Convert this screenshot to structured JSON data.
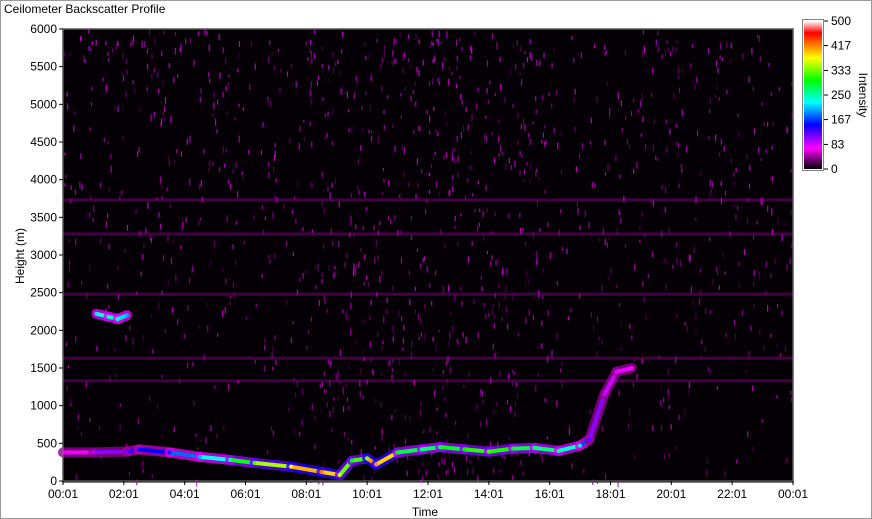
{
  "window": {
    "title": "Ceilometer Backscatter Profile"
  },
  "chart_data": {
    "type": "heatmap",
    "title": "Ceilometer Backscatter Profile",
    "xlabel": "Time",
    "ylabel": "Height (m)",
    "x_ticks": [
      "00:01",
      "02:01",
      "04:01",
      "06:01",
      "08:01",
      "10:01",
      "12:01",
      "14:01",
      "16:01",
      "18:01",
      "20:01",
      "22:01",
      "00:01"
    ],
    "x_range_hours": [
      0,
      24
    ],
    "y_ticks": [
      0,
      500,
      1000,
      1500,
      2000,
      2500,
      3000,
      3500,
      4000,
      4500,
      5000,
      5500,
      6000
    ],
    "ylim": [
      0,
      6000
    ],
    "colorbar": {
      "label": "Intensity",
      "ticks": [
        0,
        83,
        167,
        250,
        333,
        417,
        500
      ],
      "range": [
        0,
        500
      ],
      "colors": [
        "#000000",
        "#ff00ff",
        "#0000ff",
        "#00ffff",
        "#00ff00",
        "#ffff00",
        "#ff0000",
        "#ffffff"
      ]
    },
    "layer_path": [
      {
        "t": 0.0,
        "h": 380
      },
      {
        "t": 1.0,
        "h": 380
      },
      {
        "t": 2.1,
        "h": 390
      },
      {
        "t": 2.5,
        "h": 420
      },
      {
        "t": 3.5,
        "h": 380
      },
      {
        "t": 4.5,
        "h": 320
      },
      {
        "t": 5.5,
        "h": 280
      },
      {
        "t": 6.3,
        "h": 240
      },
      {
        "t": 7.5,
        "h": 190
      },
      {
        "t": 8.5,
        "h": 120
      },
      {
        "t": 9.1,
        "h": 80
      },
      {
        "t": 9.5,
        "h": 270
      },
      {
        "t": 10.0,
        "h": 300
      },
      {
        "t": 10.3,
        "h": 220
      },
      {
        "t": 11.0,
        "h": 380
      },
      {
        "t": 11.8,
        "h": 420
      },
      {
        "t": 12.4,
        "h": 450
      },
      {
        "t": 13.2,
        "h": 420
      },
      {
        "t": 14.0,
        "h": 390
      },
      {
        "t": 14.8,
        "h": 430
      },
      {
        "t": 15.5,
        "h": 440
      },
      {
        "t": 16.3,
        "h": 400
      },
      {
        "t": 17.0,
        "h": 470
      },
      {
        "t": 17.3,
        "h": 550
      },
      {
        "t": 17.8,
        "h": 1150
      },
      {
        "t": 18.2,
        "h": 1450
      },
      {
        "t": 18.7,
        "h": 1500
      }
    ],
    "layer_intensity": [
      60,
      90,
      120,
      140,
      160,
      200,
      260,
      320,
      380,
      420,
      360,
      300,
      340,
      480,
      300,
      260,
      280,
      300,
      320,
      290,
      270,
      260,
      220,
      120,
      90,
      80,
      70
    ],
    "upper_layer_path": [
      {
        "t": 1.1,
        "h": 2220
      },
      {
        "t": 1.5,
        "h": 2180
      },
      {
        "t": 1.8,
        "h": 2150
      },
      {
        "t": 2.1,
        "h": 2200
      }
    ],
    "upper_layer_intensity": [
      220,
      250,
      230,
      200
    ]
  }
}
